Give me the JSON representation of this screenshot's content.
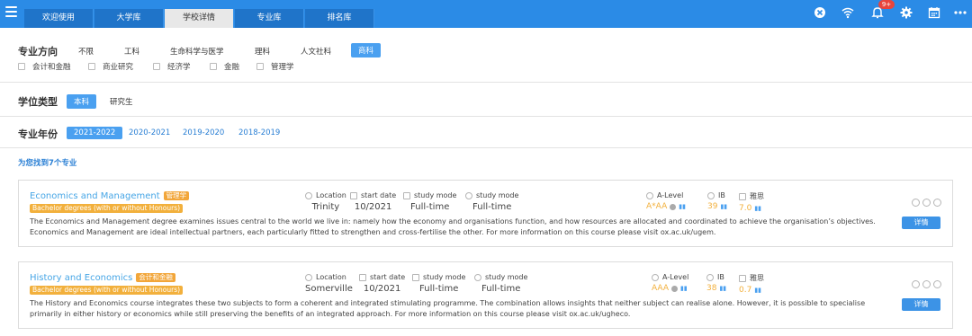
{
  "tabs": [
    {
      "label": "欢迎使用"
    },
    {
      "label": "大学库"
    },
    {
      "label": "学校详情"
    },
    {
      "label": "专业库"
    },
    {
      "label": "排名库"
    }
  ],
  "notifications_badge": "9+",
  "icons": [
    "hamburger-icon",
    "close-circle-icon",
    "wifi-icon",
    "bell-icon",
    "gear-icon",
    "calendar-icon",
    "more-icon"
  ],
  "colors": {
    "topbar": "#2b8be6",
    "accent": "#4aa0f0",
    "tag": "#f2b03c"
  },
  "filters": {
    "major_direction": {
      "label": "专业方向",
      "options": [
        "不限",
        "工科",
        "生命科学与医学",
        "理科",
        "人文社科",
        "商科"
      ],
      "selected": "商科",
      "sub_options": [
        "会计和金融",
        "商业研究",
        "经济学",
        "金融",
        "管理学"
      ]
    },
    "degree_type": {
      "label": "学位类型",
      "options": [
        "本科",
        "研究生"
      ],
      "selected": "本科"
    },
    "year": {
      "label": "专业年份",
      "options": [
        "2021-2022",
        "2020-2021",
        "2019-2020",
        "2018-2019"
      ],
      "selected": "2021-2022"
    }
  },
  "results_text": "为您找到7个专业",
  "meta_labels": {
    "location": "Location",
    "start_date": "start date",
    "study_mode_1": "study mode",
    "study_mode_2": "study mode",
    "alevel": "A-Level",
    "ib": "IB",
    "ielts": "雅思"
  },
  "courses": [
    {
      "title": "Economics and Management",
      "tag": "管理学",
      "degree": "Bachelor degrees (with or without Honours)",
      "location": "Trinity",
      "start_date": "10/2021",
      "study_mode_1": "Full-time",
      "study_mode_2": "Full-time",
      "alevel": "A*AA",
      "ib": "39",
      "ielts": "7.0",
      "description": "The Economics and Management degree examines issues central to the world we live in: namely how the economy and organisations function, and how resources are allocated and coordinated to achieve the organisation’s objectives. Economics and Management are ideal intellectual partners, each particularly fitted to strengthen and cross-fertilise the other. For more information on this course please visit ox.ac.uk/ugem.",
      "detail_button": "详情"
    },
    {
      "title": "History and Economics",
      "tag": "会计和金融",
      "degree": "Bachelor degrees (with or without Honours)",
      "location": "Somerville",
      "start_date": "10/2021",
      "study_mode_1": "Full-time",
      "study_mode_2": "Full-time",
      "alevel": "AAA",
      "ib": "38",
      "ielts": "0.7",
      "description": "The History and Economics course integrates these two subjects to form a coherent and integrated stimulating programme. The combination allows insights that neither subject can realise alone. However, it is possible to specialise primarily in either history or economics while still preserving the benefits of an integrated approach. For more information on this course please visit ox.ac.uk/ugheco.",
      "detail_button": "详情"
    }
  ]
}
